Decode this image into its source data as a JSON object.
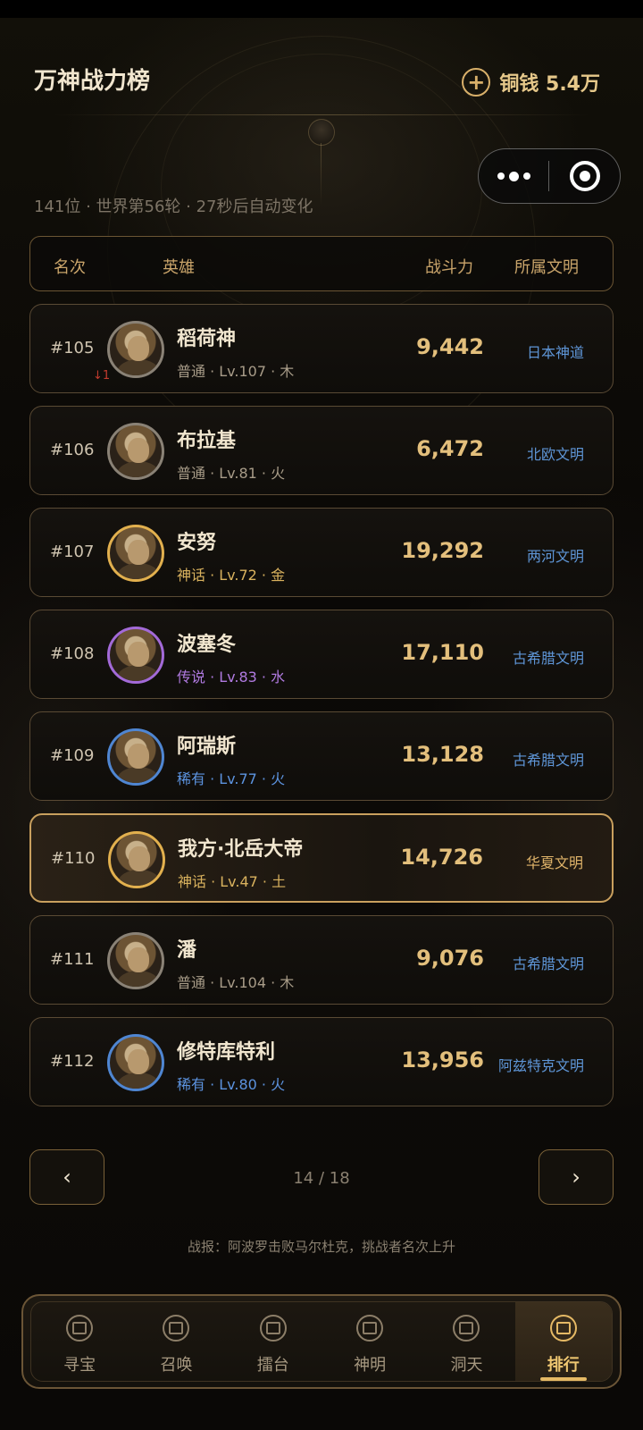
{
  "header": {
    "title": "万神战力榜",
    "currency_label": "铜钱 5.4万"
  },
  "subinfo": "141位 · 世界第56轮 · 27秒后自动变化",
  "columns": {
    "rank": "名次",
    "hero": "英雄",
    "power": "战斗力",
    "civ": "所属文明"
  },
  "rows": [
    {
      "rank": "#105",
      "name": "稻荷神",
      "meta": "普通 · Lv.107 · 木",
      "rarity": "common",
      "power": "9,442",
      "civ": "日本神道",
      "trend": "↓1"
    },
    {
      "rank": "#106",
      "name": "布拉基",
      "meta": "普通 · Lv.81 · 火",
      "rarity": "common",
      "power": "6,472",
      "civ": "北欧文明",
      "trend": ""
    },
    {
      "rank": "#107",
      "name": "安努",
      "meta": "神话 · Lv.72 · 金",
      "rarity": "mythic",
      "power": "19,292",
      "civ": "两河文明",
      "trend": ""
    },
    {
      "rank": "#108",
      "name": "波塞冬",
      "meta": "传说 · Lv.83 · 水",
      "rarity": "legend",
      "power": "17,110",
      "civ": "古希腊文明",
      "trend": ""
    },
    {
      "rank": "#109",
      "name": "阿瑞斯",
      "meta": "稀有 · Lv.77 · 火",
      "rarity": "rare",
      "power": "13,128",
      "civ": "古希腊文明",
      "trend": ""
    },
    {
      "rank": "#110",
      "name": "我方·北岳大帝",
      "meta": "神话 · Lv.47 · 土",
      "rarity": "mythic",
      "power": "14,726",
      "civ": "华夏文明",
      "trend": ""
    },
    {
      "rank": "#111",
      "name": "潘",
      "meta": "普通 · Lv.104 · 木",
      "rarity": "common",
      "power": "9,076",
      "civ": "古希腊文明",
      "trend": ""
    },
    {
      "rank": "#112",
      "name": "修特库特利",
      "meta": "稀有 · Lv.80 · 火",
      "rarity": "rare",
      "power": "13,956",
      "civ": "阿兹特克文明",
      "trend": ""
    }
  ],
  "pager": {
    "prev": "‹",
    "next": "›",
    "text": "14 / 18"
  },
  "news": "战报：阿波罗击败马尔杜克，挑战者名次上升",
  "tabs": [
    {
      "label": "寻宝"
    },
    {
      "label": "召唤"
    },
    {
      "label": "擂台"
    },
    {
      "label": "神明"
    },
    {
      "label": "洞天"
    },
    {
      "label": "排行"
    }
  ],
  "colors": {
    "accent": "#e5b965",
    "mythic": "#e2b04e",
    "legend": "#a36ad8",
    "rare": "#4f86d2",
    "common": "#8a8276"
  }
}
